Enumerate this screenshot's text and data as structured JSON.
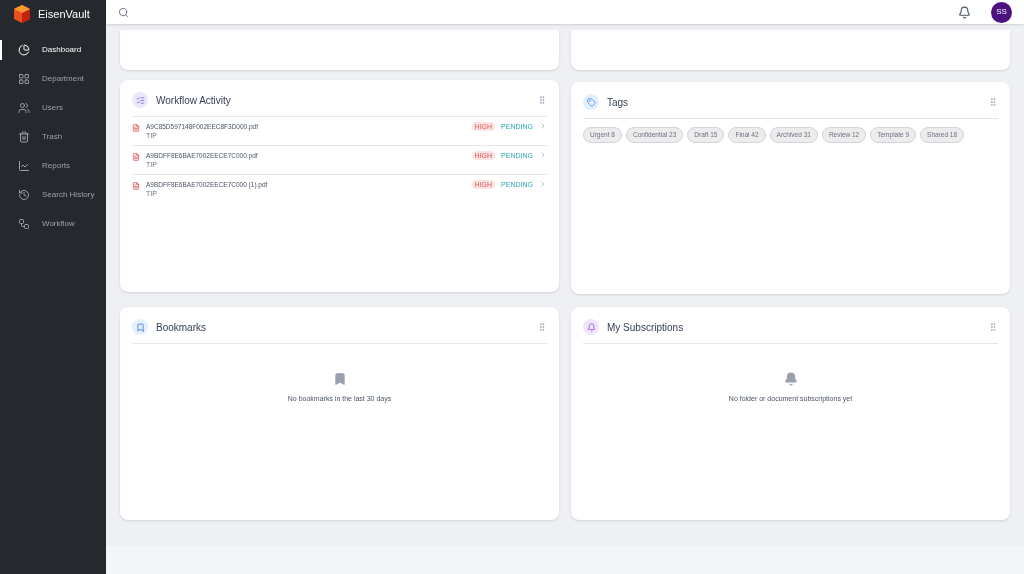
{
  "brand": {
    "name": "EisenVault"
  },
  "sidebar": {
    "items": [
      {
        "label": "Dashboard",
        "selected": true
      },
      {
        "label": "Department",
        "selected": false
      },
      {
        "label": "Users",
        "selected": false
      },
      {
        "label": "Trash",
        "selected": false
      },
      {
        "label": "Reports",
        "selected": false
      },
      {
        "label": "Search History",
        "selected": false
      },
      {
        "label": "Workflow",
        "selected": false
      }
    ]
  },
  "topbar": {
    "avatar": "SS"
  },
  "workflow_activity": {
    "title": "Workflow Activity",
    "items": [
      {
        "file": "A9C85D597148F002EEC8F3D000.pdf",
        "type": "TIP",
        "priority": "HIGH",
        "status": "PENDING"
      },
      {
        "file": "A9BDFF8E6BAE7002EECE7C000.pdf",
        "type": "TIP",
        "priority": "HIGH",
        "status": "PENDING"
      },
      {
        "file": "A9BDFF8E6BAE7002EECE7C000 (1).pdf",
        "type": "TIP",
        "priority": "HIGH",
        "status": "PENDING"
      }
    ]
  },
  "tags": {
    "title": "Tags",
    "items": [
      "Urgent 8",
      "Confidential 23",
      "Draft 15",
      "Final 42",
      "Archived 31",
      "Review 12",
      "Template 9",
      "Shared 18"
    ]
  },
  "bookmarks": {
    "title": "Bookmarks",
    "empty": "No bookmarks in the last 30 days"
  },
  "subscriptions": {
    "title": "My Subscriptions",
    "empty": "No folder or document subscriptions yet"
  }
}
